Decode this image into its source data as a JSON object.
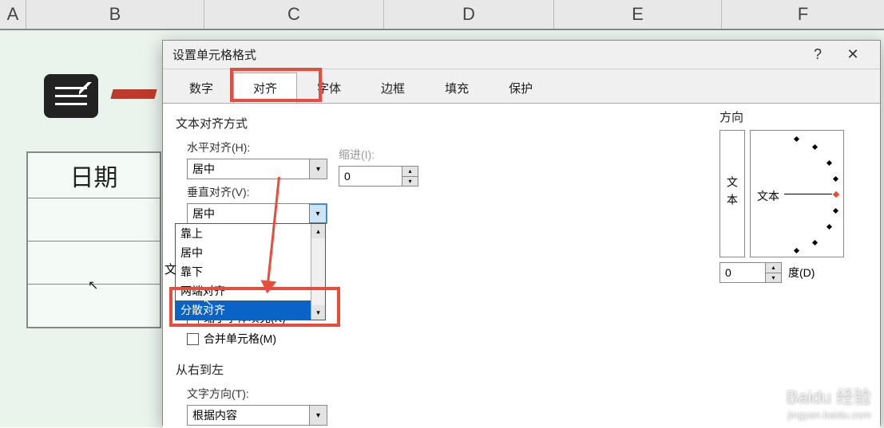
{
  "columns": {
    "A": "A",
    "B": "B",
    "C": "C",
    "D": "D",
    "E": "E",
    "F": "F"
  },
  "sheet": {
    "date_label": "日期"
  },
  "dialog": {
    "title": "设置单元格格式",
    "help": "?",
    "close": "✕",
    "tabs": [
      "数字",
      "对齐",
      "字体",
      "边框",
      "填充",
      "保护"
    ],
    "active_tab": 1,
    "align": {
      "section": "文本对齐方式",
      "h_label": "水平对齐(H):",
      "h_value": "居中",
      "v_label": "垂直对齐(V):",
      "v_value": "居中",
      "indent_label": "缩进(I):",
      "indent_value": "0",
      "v_options": [
        "靠上",
        "居中",
        "靠下",
        "两端对齐",
        "分散对齐"
      ],
      "v_selected_index": 4,
      "shrink_label": "缩小字体填充(K)",
      "merge_label": "合并单元格(M)",
      "text_ctrl_prefix": "文"
    },
    "rtl": {
      "section": "从右到左",
      "dir_label": "文字方向(T):",
      "dir_value": "根据内容"
    },
    "orient": {
      "section": "方向",
      "vert_text": "文本",
      "dial_text": "文本",
      "degree_value": "0",
      "degree_label": "度(D)"
    }
  },
  "watermark": {
    "main": "Baidu 经验",
    "sub": "jingyan.baidu.com"
  }
}
